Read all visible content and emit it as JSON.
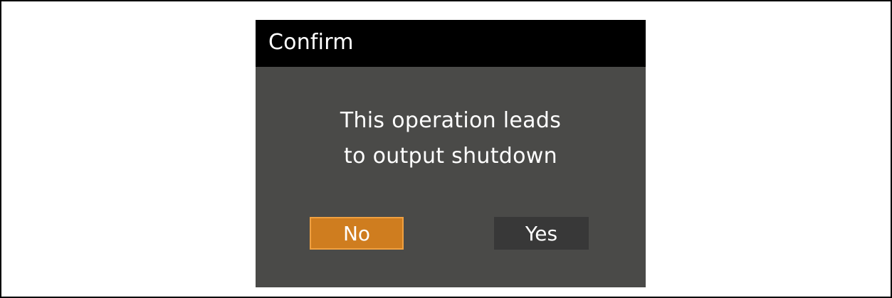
{
  "dialog": {
    "title": "Confirm",
    "message_lines": [
      "This operation leads",
      "to output shutdown"
    ],
    "buttons": {
      "no_label": "No",
      "yes_label": "Yes"
    },
    "selected_button": "No",
    "colors": {
      "title_bar": "#000000",
      "body": "#4a4a48",
      "selected_button": "#cf7d1f",
      "unselected_button": "#383838",
      "text": "#ffffff"
    }
  }
}
